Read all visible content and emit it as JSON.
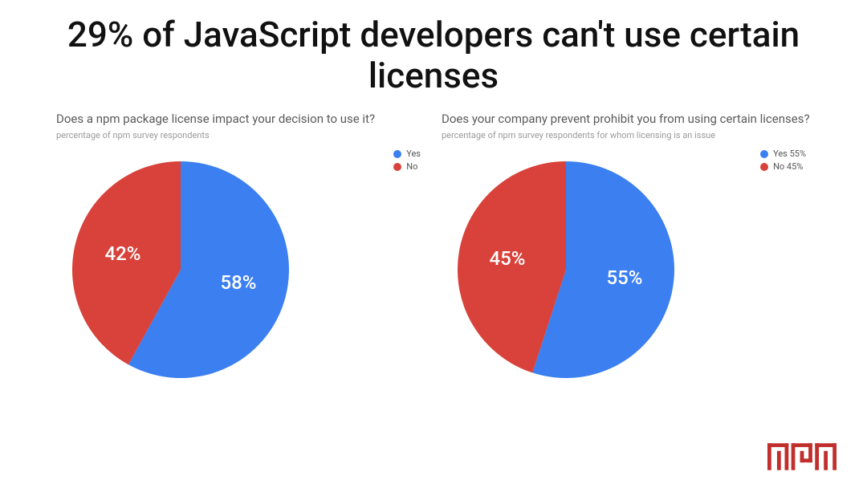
{
  "headline": "29% of JavaScript developers can't use certain licenses",
  "colors": {
    "yes": "#3b7ff0",
    "no": "#d8423a"
  },
  "logo": {
    "name": "npm"
  },
  "chart_data": [
    {
      "type": "pie",
      "title": "Does a npm package license impact your decision to use it?",
      "subtitle": "percentage of npm survey respondents",
      "series": [
        {
          "name": "Yes",
          "value": 58,
          "label": "58%",
          "legend": "Yes",
          "color": "#3b7ff0"
        },
        {
          "name": "No",
          "value": 42,
          "label": "42%",
          "legend": "No",
          "color": "#d8423a"
        }
      ]
    },
    {
      "type": "pie",
      "title": "Does your company prevent prohibit you from using certain licenses?",
      "subtitle": "percentage of npm survey respondents for whom licensing is an issue",
      "series": [
        {
          "name": "Yes",
          "value": 55,
          "label": "55%",
          "legend": "Yes 55%",
          "color": "#3b7ff0"
        },
        {
          "name": "No",
          "value": 45,
          "label": "45%",
          "legend": "No 45%",
          "color": "#d8423a"
        }
      ]
    }
  ]
}
